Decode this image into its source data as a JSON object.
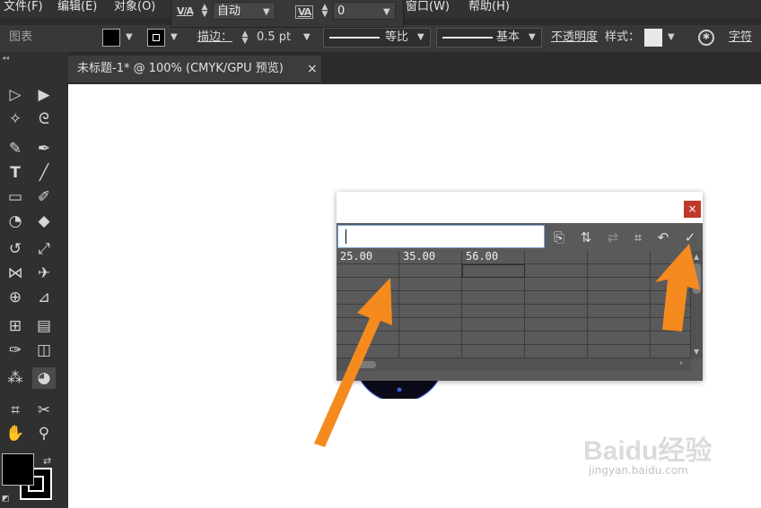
{
  "menu": {
    "items": [
      "文件(F)",
      "编辑(E)",
      "对象(O)",
      "窗口(W)",
      "帮助(H)"
    ]
  },
  "char_panel": {
    "tracking_value": "自动",
    "kerning_value": "0"
  },
  "control_bar": {
    "label": "图表",
    "stroke_label": "描边：",
    "stroke_weight": "0.5 pt",
    "stroke_profile": "等比",
    "brush": "基本",
    "opacity_label": "不透明度",
    "style_label": "样式：",
    "char_label": "字符"
  },
  "document": {
    "tab_title": "未标题-1* @ 100% (CMYK/GPU 预览)",
    "tab_close": "×"
  },
  "dialog": {
    "close": "×",
    "input_value": "",
    "rows": [
      [
        "25.00",
        "35.00",
        "56.00",
        "",
        "",
        ""
      ],
      [
        "",
        "",
        "",
        "",
        "",
        ""
      ],
      [
        "",
        "",
        "",
        "",
        "",
        ""
      ],
      [
        "",
        "",
        "",
        "",
        "",
        ""
      ],
      [
        "",
        "",
        "",
        "",
        "",
        ""
      ],
      [
        "",
        "",
        "",
        "",
        "",
        ""
      ],
      [
        "",
        "",
        "",
        "",
        "",
        ""
      ],
      [
        "",
        "",
        "",
        "",
        "",
        ""
      ]
    ]
  },
  "colors": {
    "accent_arrow": "#f58a1f",
    "chrome_dark": "#2b2b2b",
    "dialog_grid": "#5a5a5a",
    "close_red": "#c0392b"
  },
  "watermark": {
    "brand": "Baidu经验",
    "url": "jingyan.baidu.com"
  }
}
